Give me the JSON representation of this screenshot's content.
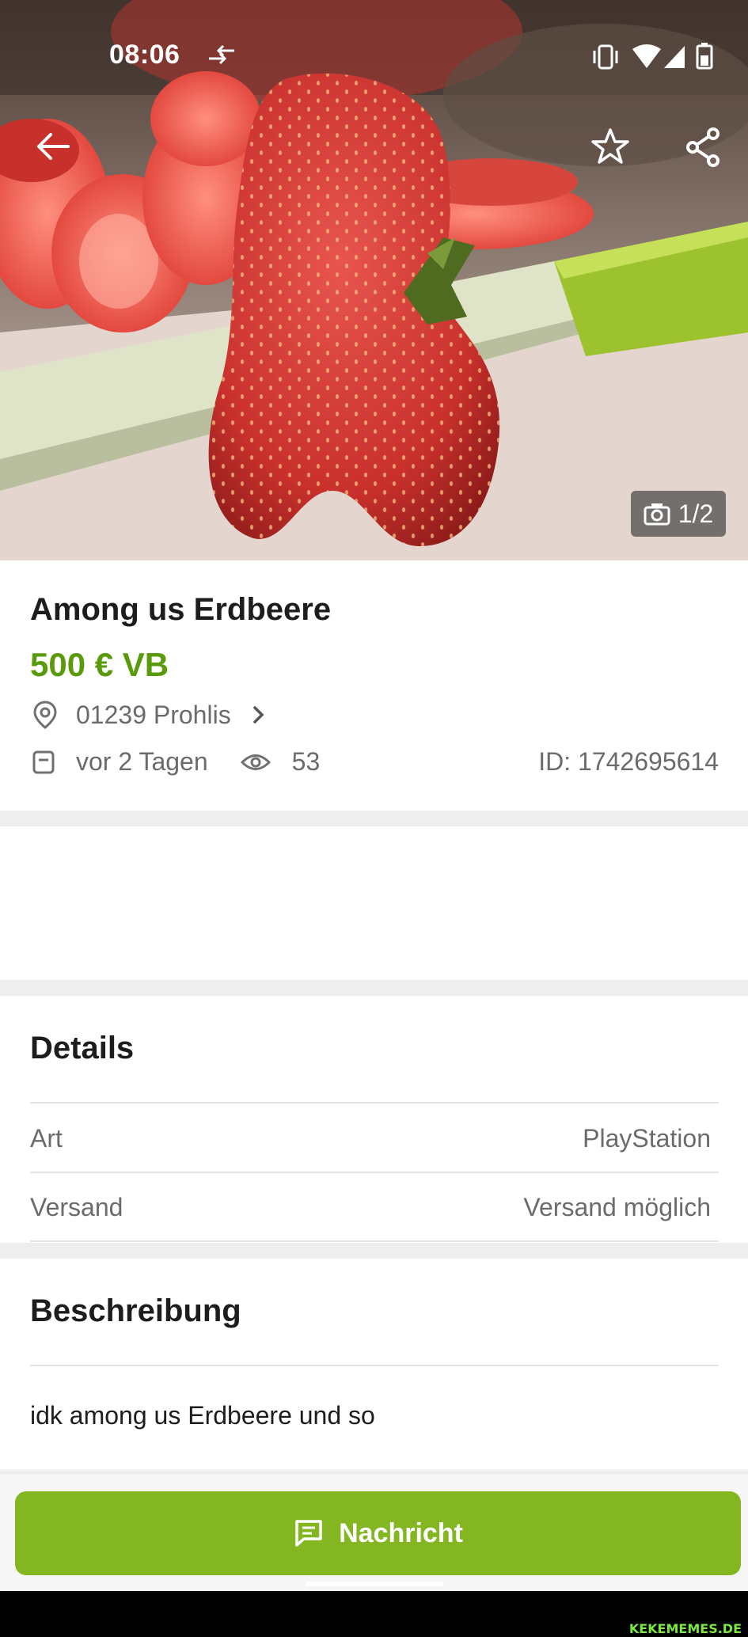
{
  "status_bar": {
    "time": "08:06"
  },
  "header": {
    "photo_counter": "1/2"
  },
  "listing": {
    "title": "Among us Erdbeere",
    "price": "500 € VB",
    "location": "01239 Prohlis",
    "posted": "vor 2 Tagen",
    "views": "53",
    "id": "ID: 1742695614"
  },
  "details": {
    "heading": "Details",
    "rows": [
      {
        "label": "Art",
        "value": "PlayStation"
      },
      {
        "label": "Versand",
        "value": "Versand möglich"
      }
    ]
  },
  "description": {
    "heading": "Beschreibung",
    "text": "idk among us Erdbeere und so"
  },
  "actions": {
    "message_label": "Nachricht"
  },
  "watermark": "KEKEMEMES.DE",
  "colors": {
    "price_green": "#5a9b0b",
    "button_green": "#83b620"
  }
}
